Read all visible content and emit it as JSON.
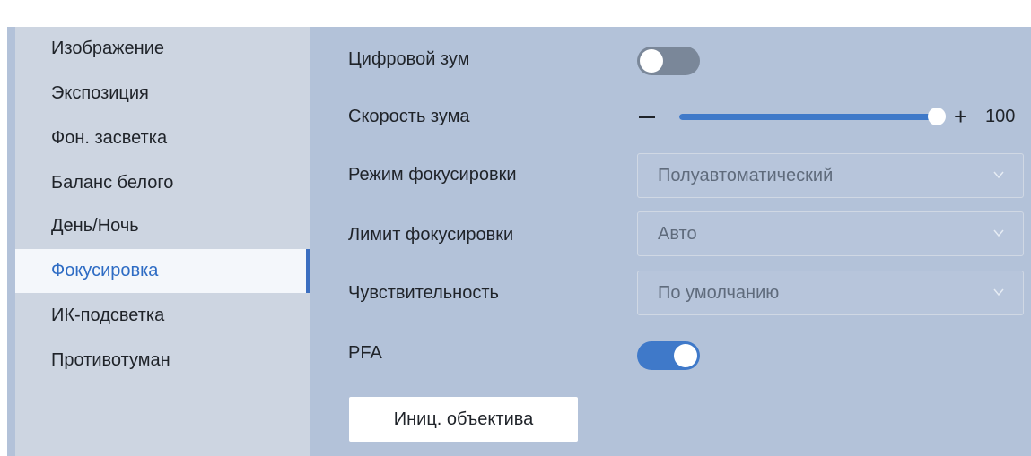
{
  "sidebar": {
    "items": [
      {
        "label": "Изображение"
      },
      {
        "label": "Экспозиция"
      },
      {
        "label": "Фон. засветка"
      },
      {
        "label": "Баланс белого"
      },
      {
        "label": "День/Ночь"
      },
      {
        "label": "Фокусировка",
        "active": true
      },
      {
        "label": "ИК-подсветка"
      },
      {
        "label": "Противотуман"
      }
    ]
  },
  "settings": {
    "digital_zoom": {
      "label": "Цифровой зум",
      "enabled": false
    },
    "zoom_speed": {
      "label": "Скорость зума",
      "minus_icon": "minus-icon",
      "plus_icon": "plus-icon",
      "value": "100",
      "min": 0,
      "max": 100
    },
    "focus_mode": {
      "label": "Режим фокусировки",
      "selected": "Полуавтоматический"
    },
    "focus_limit": {
      "label": "Лимит фокусировки",
      "selected": "Авто"
    },
    "sensitivity": {
      "label": "Чувствительность",
      "selected": "По умолчанию"
    },
    "pfa": {
      "label": "PFA",
      "enabled": true
    }
  },
  "actions": {
    "init_lens_label": "Иниц. объектива"
  },
  "colors": {
    "accent": "#3f79c9",
    "active_text": "#2e6cc4",
    "panel_bg": "#b3c2d9",
    "sidebar_bg": "#cdd5e1"
  }
}
